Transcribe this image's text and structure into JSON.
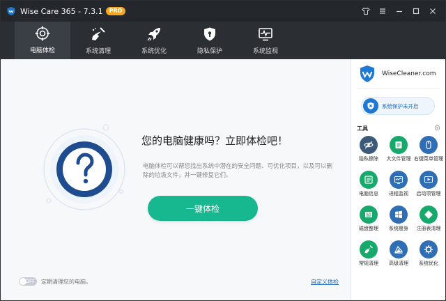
{
  "window": {
    "title": "Wise Care 365 - 7.3.1",
    "badge": "PRO"
  },
  "nav": {
    "tabs": [
      {
        "label": "电脑体检",
        "icon": "crosshair-icon",
        "active": true
      },
      {
        "label": "系统清理",
        "icon": "broom-icon",
        "active": false
      },
      {
        "label": "系统优化",
        "icon": "rocket-icon",
        "active": false
      },
      {
        "label": "隐私保护",
        "icon": "shield-lock-icon",
        "active": false
      },
      {
        "label": "系统监视",
        "icon": "monitor-pulse-icon",
        "active": false
      }
    ]
  },
  "main": {
    "question": "您的电脑健康吗？立即体检吧！",
    "description": "电脑体检可以帮您找出系统中潜在的安全问题、可优化项目，以及可以删除的垃圾文件，并一键修复它们。",
    "scan_button": "一键体检",
    "toggle_state": "OFF",
    "toggle_label": "定期清理您的电脑。",
    "custom_link": "自定义体检"
  },
  "sidebar": {
    "brand": "WiseCleaner.com",
    "protection_status": "系统保护未开启",
    "tools_title": "工具",
    "tools": [
      {
        "label": "隐私擦除",
        "icon": "eye-off-icon",
        "color": "#3b5a7a"
      },
      {
        "label": "大文件管理",
        "icon": "file-list-icon",
        "color": "#17a86b"
      },
      {
        "label": "右键菜单管理",
        "icon": "mouse-icon",
        "color": "#2f6db5"
      },
      {
        "label": "电脑信息",
        "icon": "computer-info-icon",
        "color": "#17a86b"
      },
      {
        "label": "进程监视",
        "icon": "process-monitor-icon",
        "color": "#2f6db5"
      },
      {
        "label": "启动项管理",
        "icon": "startup-icon",
        "color": "#2f6db5"
      },
      {
        "label": "磁盘整理",
        "icon": "disk-defrag-icon",
        "color": "#17a86b"
      },
      {
        "label": "系统瘦身",
        "icon": "windows-icon",
        "color": "#2f6db5"
      },
      {
        "label": "注册表清理",
        "icon": "registry-icon",
        "color": "#17a86b"
      },
      {
        "label": "常规清理",
        "icon": "broom-clean-icon",
        "color": "#17a86b"
      },
      {
        "label": "高级清理",
        "icon": "advanced-clean-icon",
        "color": "#2f6db5"
      },
      {
        "label": "系统优化",
        "icon": "gear-optimize-icon",
        "color": "#2f6db5"
      }
    ]
  }
}
